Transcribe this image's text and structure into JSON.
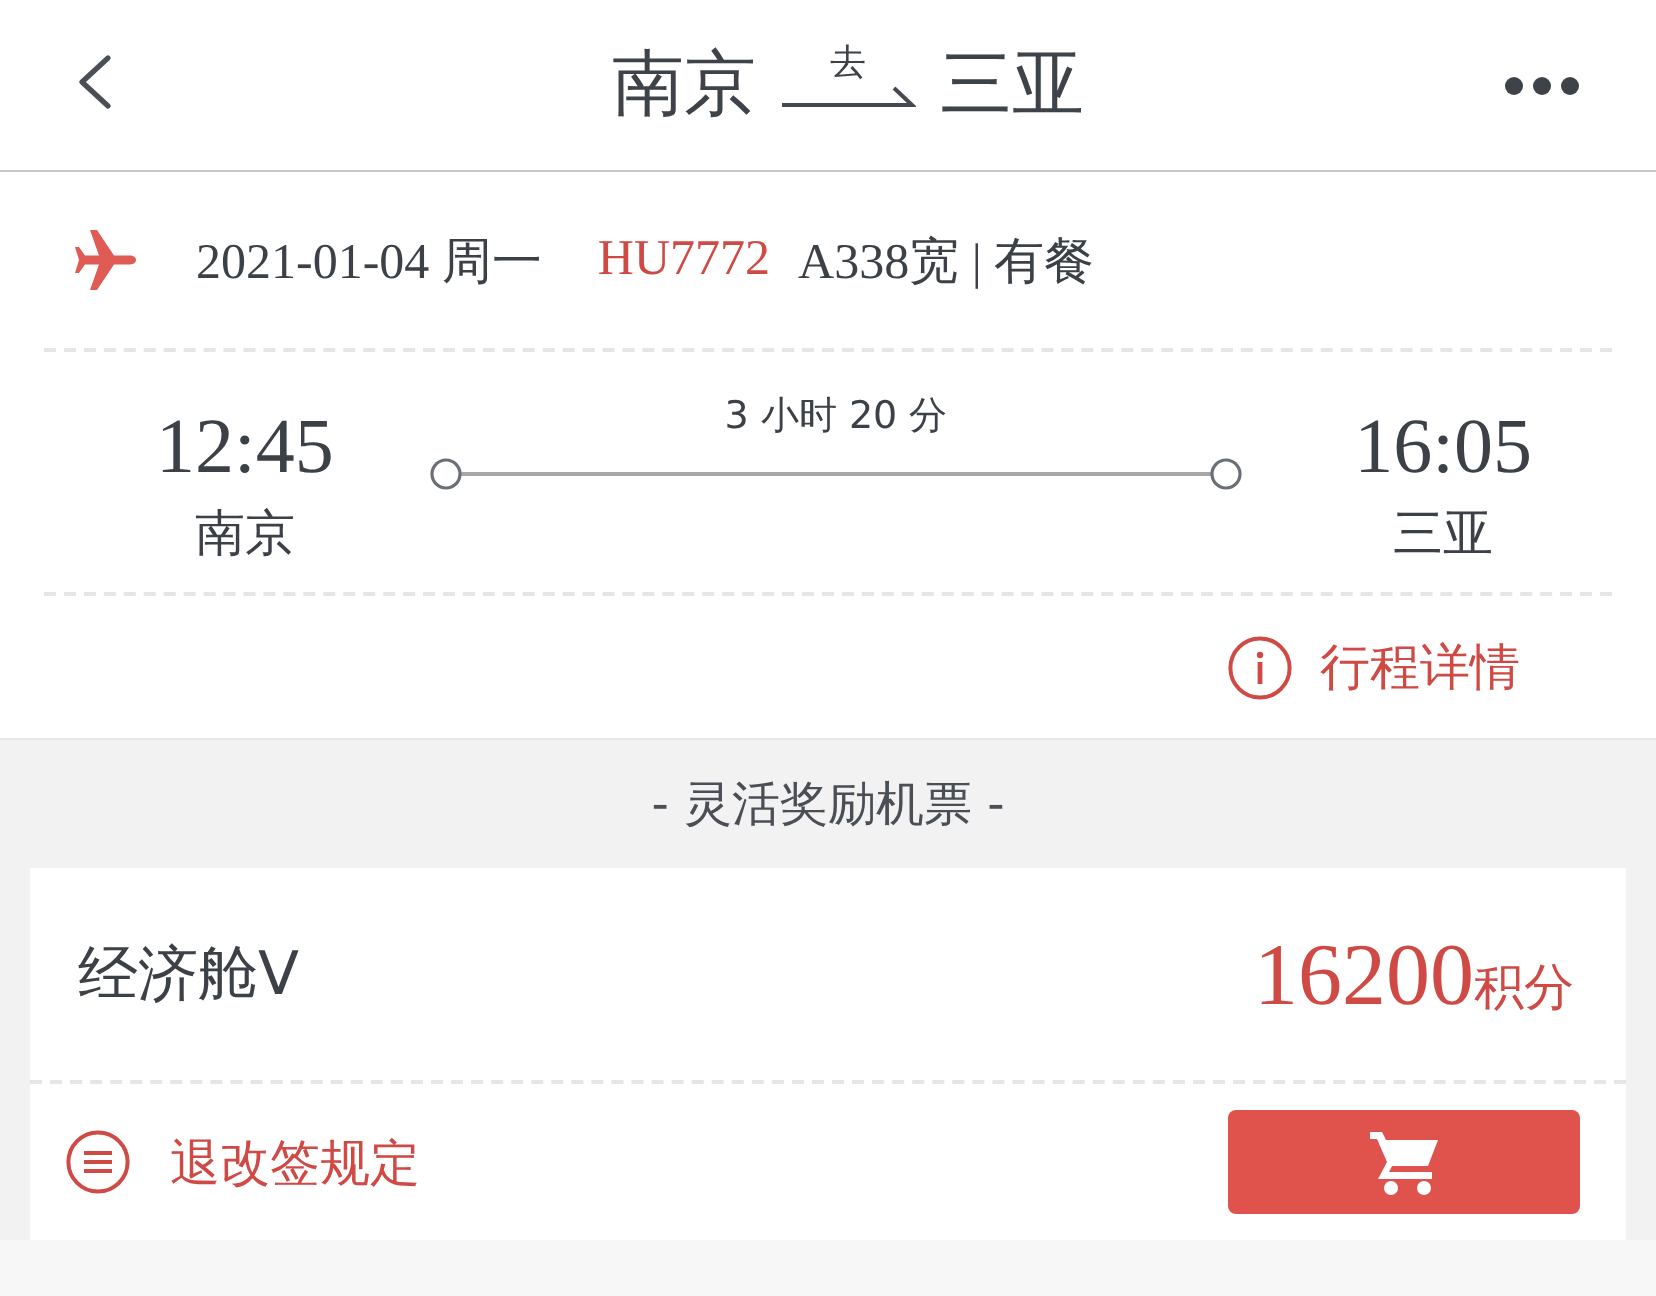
{
  "header": {
    "origin": "南京",
    "direction": "去",
    "destination": "三亚"
  },
  "flight": {
    "date": "2021-01-04 周一",
    "flight_no": "HU7772",
    "aircraft": "A338宽 | 有餐"
  },
  "schedule": {
    "departure_time": "12:45",
    "departure_city": "南京",
    "duration": "3 小时 20 分",
    "arrival_time": "16:05",
    "arrival_city": "三亚"
  },
  "details_link": "行程详情",
  "section_title": "- 灵活奖励机票 -",
  "fares": [
    {
      "cabin": "经济舱V",
      "points": "16200",
      "unit": "积分",
      "rules_link": "退改签规定"
    }
  ]
}
